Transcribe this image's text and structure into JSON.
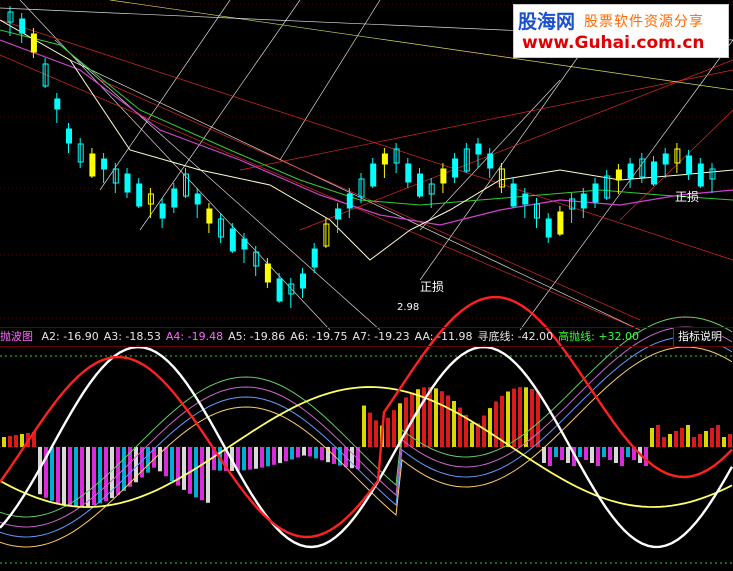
{
  "watermark": {
    "site": "股海网",
    "slogan": "股票软件资源分享",
    "url": "www.Guhai.com.cn"
  },
  "indicator_bar": {
    "name": "抛波图",
    "items": [
      {
        "label": "A2:",
        "value": "-16.90",
        "color": "#e6e6e6"
      },
      {
        "label": "A3:",
        "value": "-18.53",
        "color": "#e6e6e6"
      },
      {
        "label": "A4:",
        "value": "-19.48",
        "color": "#ff66ff"
      },
      {
        "label": "A5:",
        "value": "-19.86",
        "color": "#e6e6e6"
      },
      {
        "label": "A6:",
        "value": "-19.75",
        "color": "#e6e6e6"
      },
      {
        "label": "A7:",
        "value": "-19.23",
        "color": "#e6e6e6"
      },
      {
        "label": "AA:",
        "value": "-11.98",
        "color": "#e6e6e6"
      },
      {
        "label": "寻底线:",
        "value": "-42.00",
        "color": "#e6e6e6"
      },
      {
        "label": "高抛线:",
        "value": "+32.00",
        "color": "#33ff33"
      }
    ],
    "help_button": "指标说明"
  },
  "annotations": {
    "zhengsun_label": "正损",
    "low_price": "2.98"
  },
  "colors": {
    "up_candle": "#00ffff",
    "yellow_candle": "#ffff00",
    "white_line": "#ffffff",
    "red_line": "#ff2020",
    "yellow_line": "#ffff66",
    "magenta_bar": "#ff33ff",
    "grid_red": "#550000"
  },
  "chart_data": [
    {
      "type": "line",
      "panel": "price",
      "low_marker": 2.98,
      "series": []
    },
    {
      "type": "line",
      "panel": "oscillator",
      "title": "抛波图",
      "series": [
        {
          "name": "A2",
          "last": -16.9
        },
        {
          "name": "A3",
          "last": -18.53
        },
        {
          "name": "A4",
          "last": -19.48
        },
        {
          "name": "A5",
          "last": -19.86
        },
        {
          "name": "A6",
          "last": -19.75
        },
        {
          "name": "A7",
          "last": -19.23
        },
        {
          "name": "AA",
          "last": -11.98
        },
        {
          "name": "寻底线",
          "last": -42.0
        },
        {
          "name": "高抛线",
          "last": 32.0
        }
      ]
    }
  ]
}
